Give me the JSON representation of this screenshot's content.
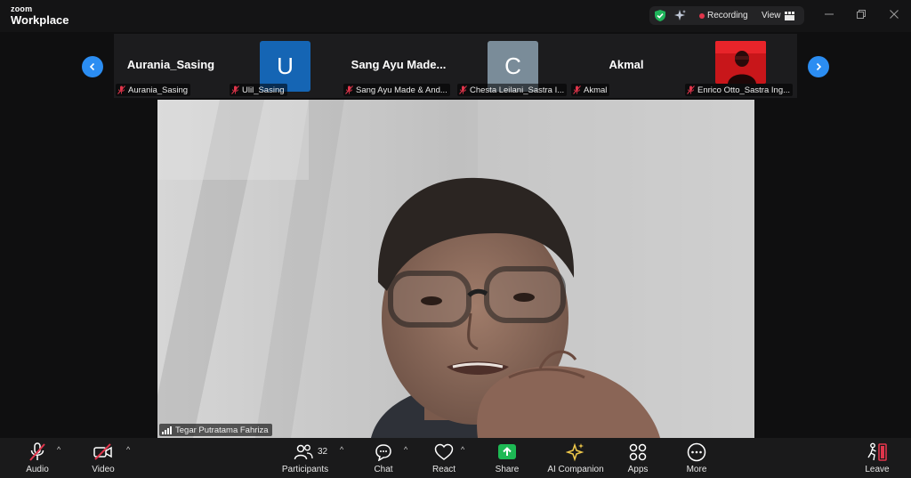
{
  "window": {
    "brand_top": "zoom",
    "brand_bottom": "Workplace",
    "recording_label": "Recording",
    "view_label": "View"
  },
  "gallery": {
    "tiles": [
      {
        "big_name": "Aurania_Sasing",
        "label": "Aurania_Sasing"
      },
      {
        "avatar_letter": "U",
        "avatar_color": "#1565b4",
        "label": "Ulil_Sasing"
      },
      {
        "big_name": "Sang Ayu Made...",
        "label": "Sang Ayu Made & And..."
      },
      {
        "avatar_letter": "C",
        "avatar_color": "#7a8c99",
        "label": "Chesta Leilani_Sastra I..."
      },
      {
        "big_name": "Akmal",
        "label": "Akmal"
      },
      {
        "label": "Enrico Otto_Sastra Ing..."
      }
    ]
  },
  "main": {
    "speaker_name": "Tegar Putratama Fahriza"
  },
  "toolbar": {
    "audio": "Audio",
    "video": "Video",
    "participants": "Participants",
    "participants_count": "32",
    "chat": "Chat",
    "react": "React",
    "share": "Share",
    "ai_companion": "AI Companion",
    "apps": "Apps",
    "more": "More",
    "leave": "Leave"
  },
  "colors": {
    "accent_blue": "#2b8df2",
    "share_green": "#1db954",
    "recording_red": "#e0354b",
    "leave_red": "#e0354b",
    "ai_gold": "#f0c94a"
  }
}
